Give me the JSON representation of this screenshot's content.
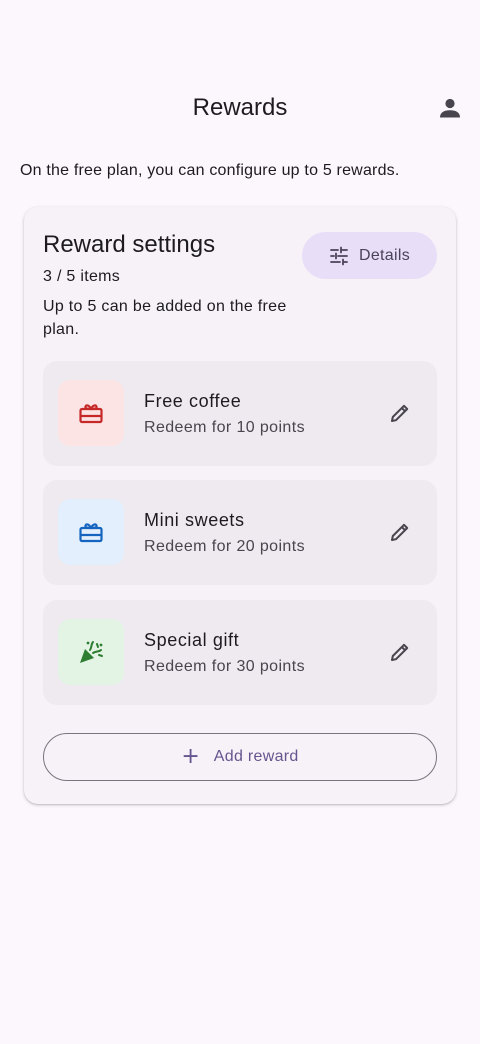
{
  "app_bar": {
    "title": "Rewards",
    "account_icon": "person-icon"
  },
  "intro_text": "On the free plan, you can configure up to 5 rewards.",
  "settings": {
    "title": "Reward settings",
    "count": "3 / 5 items",
    "hint": "Up to 5 can be added on the free plan.",
    "details_label": "Details",
    "details_icon": "tune-icon",
    "add_label": "Add reward",
    "add_icon": "plus-icon"
  },
  "rewards": [
    {
      "name": "Free coffee",
      "subtitle": "Redeem for 10 points",
      "icon": "redeem-card-icon",
      "icon_color": "#c62828",
      "icon_bg": "#fde4e4"
    },
    {
      "name": "Mini sweets",
      "subtitle": "Redeem for 20 points",
      "icon": "redeem-card-icon",
      "icon_color": "#1565c0",
      "icon_bg": "#e3effc"
    },
    {
      "name": "Special gift",
      "subtitle": "Redeem for 30 points",
      "icon": "celebration-icon",
      "icon_color": "#2e7d32",
      "icon_bg": "#e3f4e4"
    }
  ],
  "edit_icon": "pencil-icon"
}
